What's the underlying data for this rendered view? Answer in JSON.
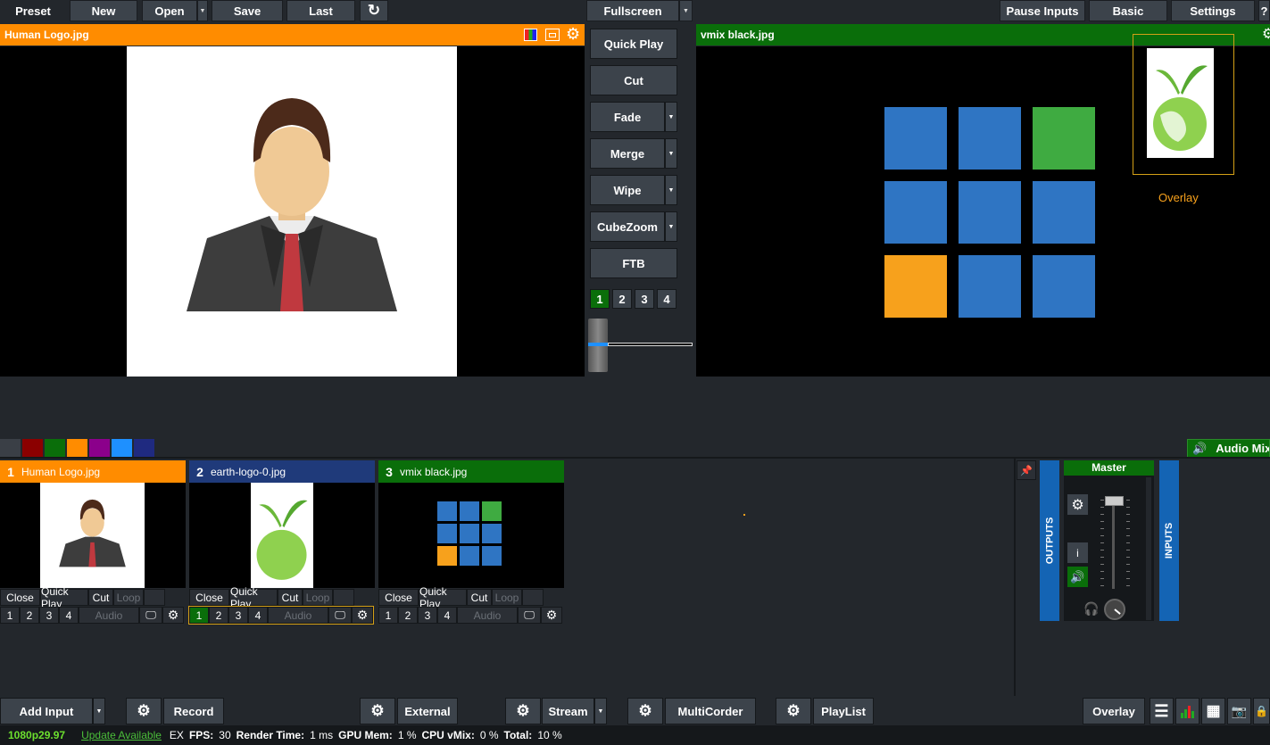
{
  "toolbar": {
    "preset": "Preset",
    "new": "New",
    "open": "Open",
    "save": "Save",
    "last": "Last",
    "fullscreen": "Fullscreen",
    "pause_inputs": "Pause Inputs",
    "basic": "Basic",
    "settings": "Settings",
    "help": "?"
  },
  "preview": {
    "title": "Human Logo.jpg",
    "color": "#ff8c00"
  },
  "output": {
    "title": "vmix black.jpg",
    "color": "#0a6e0a",
    "overlay_label": "Overlay"
  },
  "transitions": {
    "quick_play": "Quick Play",
    "cut": "Cut",
    "fade": "Fade",
    "merge": "Merge",
    "wipe": "Wipe",
    "cubezoom": "CubeZoom",
    "ftb": "FTB",
    "nums": [
      "1",
      "2",
      "3",
      "4"
    ]
  },
  "tiles_colors": [
    "#2f75c3",
    "#2f75c3",
    "#3fab41",
    "#2f75c3",
    "#2f75c3",
    "#2f75c3",
    "#f7a11c",
    "#2f75c3",
    "#2f75c3"
  ],
  "swatches": [
    "#3a3f46",
    "#8b0000",
    "#0a6e0a",
    "#ff8c00",
    "#8b008b",
    "#1e90ff",
    "#1f2a80"
  ],
  "inputs": [
    {
      "number": "1",
      "name": "Human Logo.jpg",
      "color": "#ff8c00"
    },
    {
      "number": "2",
      "name": "earth-logo-0.jpg",
      "color": "#1f3a7a"
    },
    {
      "number": "3",
      "name": "vmix black.jpg",
      "color": "#0a6e0a"
    }
  ],
  "card_buttons": {
    "close": "Close",
    "quick_play": "Quick Play",
    "cut": "Cut",
    "loop": "Loop",
    "audio": "Audio",
    "nums": [
      "1",
      "2",
      "3",
      "4"
    ]
  },
  "audio": {
    "title": "Audio Mixer",
    "master": "Master",
    "outputs": "OUTPUTS",
    "inputs": "INPUTS",
    "info": "i"
  },
  "bottom": {
    "add_input": "Add Input",
    "record": "Record",
    "external": "External",
    "stream": "Stream",
    "multicorder": "MultiCorder",
    "playlist": "PlayList",
    "overlay": "Overlay"
  },
  "status": {
    "format": "1080p29.97",
    "update": "Update Available",
    "ex": "EX",
    "fps_label": "FPS:",
    "fps": "30",
    "render_label": "Render Time:",
    "render": "1 ms",
    "gpu_label": "GPU Mem:",
    "gpu": "1 %",
    "cpu_label": "CPU vMix:",
    "cpu": "0 %",
    "total_label": "Total:",
    "total": "10 %"
  }
}
